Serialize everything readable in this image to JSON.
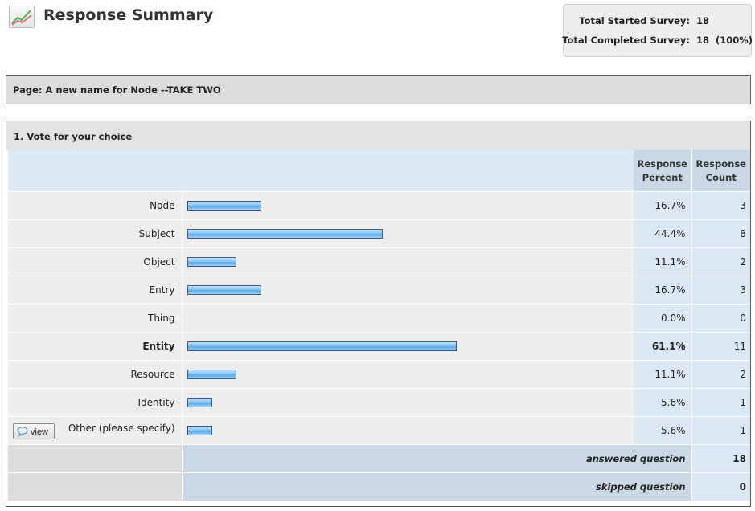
{
  "header": {
    "title": "Response Summary",
    "icon": "chart-line-icon"
  },
  "totals": {
    "started_label": "Total Started Survey:",
    "started_value": "18",
    "completed_label": "Total Completed Survey:",
    "completed_value": "18  (100%)"
  },
  "page": {
    "label": "Page: A new name for Node --TAKE TWO"
  },
  "question": {
    "title": "1. Vote for your choice",
    "col_percent_line1": "Response",
    "col_percent_line2": "Percent",
    "col_count_line1": "Response",
    "col_count_line2": "Count",
    "bar_colors": {
      "top": "#bfe2fb",
      "mid": "#5aa9e4",
      "border": "#3a5a8a"
    },
    "rows": [
      {
        "label": "Node",
        "percent": "16.7%",
        "count": "3",
        "value": 16.7
      },
      {
        "label": "Subject",
        "percent": "44.4%",
        "count": "8",
        "value": 44.4
      },
      {
        "label": "Object",
        "percent": "11.1%",
        "count": "2",
        "value": 11.1
      },
      {
        "label": "Entry",
        "percent": "16.7%",
        "count": "3",
        "value": 16.7
      },
      {
        "label": "Thing",
        "percent": "0.0%",
        "count": "0",
        "value": 0
      },
      {
        "label": "Entity",
        "percent": "61.1%",
        "count": "11",
        "value": 61.1,
        "bold": true
      },
      {
        "label": "Resource",
        "percent": "11.1%",
        "count": "2",
        "value": 11.1
      },
      {
        "label": "Identity",
        "percent": "5.6%",
        "count": "1",
        "value": 5.6
      },
      {
        "label": "Other (please specify)",
        "percent": "5.6%",
        "count": "1",
        "value": 5.6,
        "view_button": "view",
        "view_icon": "speech-bubble-icon"
      }
    ],
    "answered_label": "answered question",
    "answered_value": "18",
    "skipped_label": "skipped question",
    "skipped_value": "0"
  }
}
